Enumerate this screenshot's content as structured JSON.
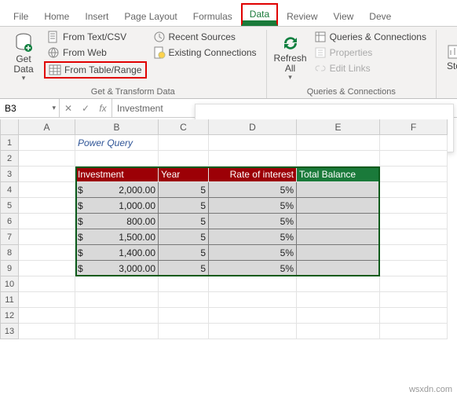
{
  "tabs": [
    "File",
    "Home",
    "Insert",
    "Page Layout",
    "Formulas",
    "Data",
    "Review",
    "View",
    "Deve"
  ],
  "active_tab": "Data",
  "ribbon": {
    "group1": {
      "title": "Get & Transform Data",
      "get_data": "Get Data",
      "from_text": "From Text/CSV",
      "from_web": "From Web",
      "from_table": "From Table/Range",
      "recent": "Recent Sources",
      "existing": "Existing Connections"
    },
    "group2": {
      "title": "Queries & Connections",
      "refresh": "Refresh All",
      "queries": "Queries & Connections",
      "props": "Properties",
      "edit_links": "Edit Links"
    },
    "group3": {
      "stocks": "Stoc"
    }
  },
  "namebox": "B3",
  "formula": "Investment",
  "columns": [
    {
      "id": "A",
      "w": 72
    },
    {
      "id": "B",
      "w": 106
    },
    {
      "id": "C",
      "w": 64
    },
    {
      "id": "D",
      "w": 112
    },
    {
      "id": "E",
      "w": 106
    },
    {
      "id": "F",
      "w": 86
    }
  ],
  "rowcount": 13,
  "title_cell": {
    "row": 1,
    "col": 1,
    "text": "Power Query"
  },
  "headers": {
    "row": 2,
    "cols": [
      "Investment",
      "Year",
      "Rate of interest",
      "Total Balance"
    ]
  },
  "data_rows": [
    {
      "inv": "2,000.00",
      "yr": "5",
      "rate": "5%"
    },
    {
      "inv": "1,000.00",
      "yr": "5",
      "rate": "5%"
    },
    {
      "inv": "800.00",
      "yr": "5",
      "rate": "5%"
    },
    {
      "inv": "1,500.00",
      "yr": "5",
      "rate": "5%"
    },
    {
      "inv": "1,400.00",
      "yr": "5",
      "rate": "5%"
    },
    {
      "inv": "3,000.00",
      "yr": "5",
      "rate": "5%"
    }
  ],
  "chart_data": {
    "type": "table",
    "title": "Power Query",
    "columns": [
      "Investment",
      "Year",
      "Rate of interest",
      "Total Balance"
    ],
    "rows": [
      [
        "$ 2,000.00",
        5,
        "5%",
        ""
      ],
      [
        "$ 1,000.00",
        5,
        "5%",
        ""
      ],
      [
        "$ 800.00",
        5,
        "5%",
        ""
      ],
      [
        "$ 1,500.00",
        5,
        "5%",
        ""
      ],
      [
        "$ 1,400.00",
        5,
        "5%",
        ""
      ],
      [
        "$ 3,000.00",
        5,
        "5%",
        ""
      ]
    ]
  },
  "watermark": "wsxdn.com"
}
